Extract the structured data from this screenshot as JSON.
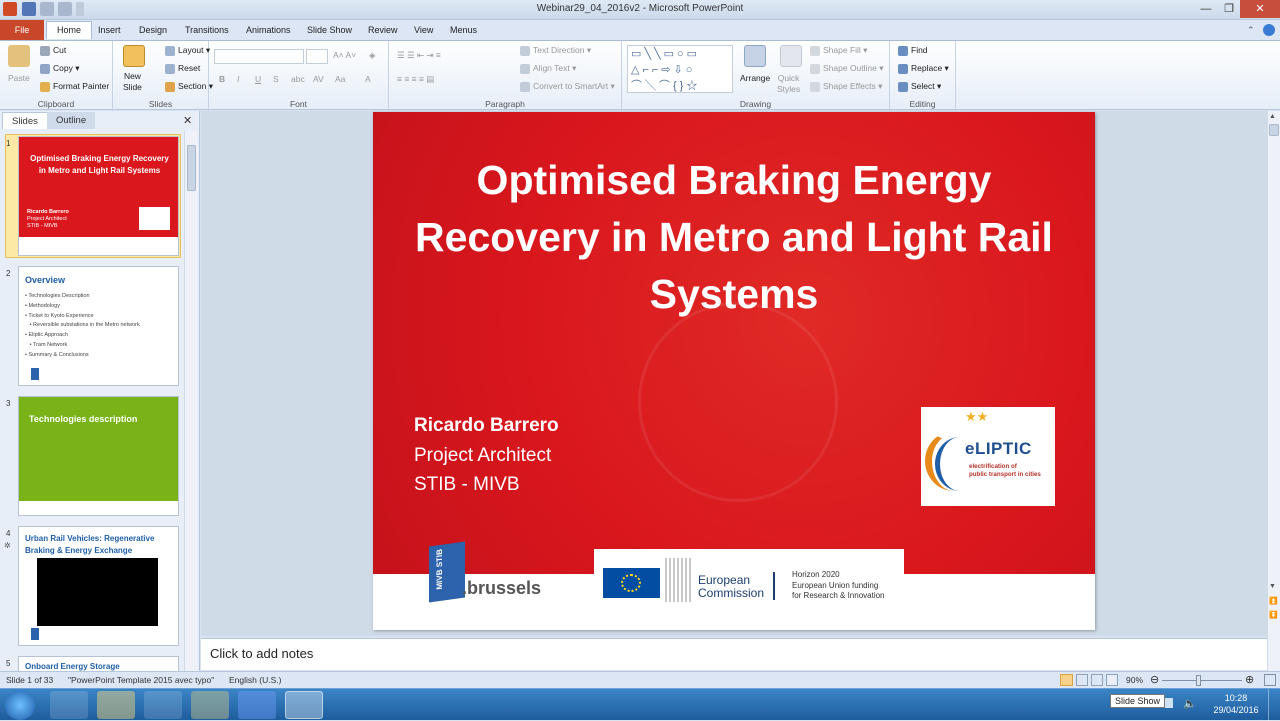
{
  "window": {
    "title": "Webinar29_04_2016v2 - Microsoft PowerPoint",
    "minimize": "—",
    "maximize": "❐",
    "close": "✕"
  },
  "tabs": [
    "Insert",
    "Design",
    "Transitions",
    "Animations",
    "Slide Show",
    "Review",
    "View",
    "Menus"
  ],
  "file_tab": "File",
  "home_tab": "Home",
  "ribbon": {
    "clipboard": {
      "paste": "Paste",
      "cut": "Cut",
      "copy": "Copy",
      "format_painter": "Format Painter",
      "label": "Clipboard"
    },
    "slides": {
      "new_slide": "New\nSlide",
      "layout": "Layout",
      "reset": "Reset",
      "section": "Section",
      "label": "Slides"
    },
    "font": {
      "label": "Font"
    },
    "paragraph": {
      "text_direction": "Text Direction",
      "align_text": "Align Text",
      "convert": "Convert to SmartArt",
      "label": "Paragraph"
    },
    "drawing": {
      "arrange": "Arrange",
      "quick_styles": "Quick\nStyles",
      "shape_fill": "Shape Fill",
      "shape_outline": "Shape Outline",
      "shape_effects": "Shape Effects",
      "label": "Drawing"
    },
    "editing": {
      "find": "Find",
      "replace": "Replace",
      "select": "Select",
      "label": "Editing"
    }
  },
  "panel": {
    "tab_slides": "Slides",
    "tab_outline": "Outline",
    "close": "✕"
  },
  "thumbs": [
    {
      "num": "1",
      "title": "Optimised Braking Energy Recovery  in Metro and Light Rail Systems",
      "l1": "Ricardo Barrero",
      "l2": "Project Architect",
      "l3": "STIB - MIVB"
    },
    {
      "num": "2",
      "title": "Overview",
      "bullets": [
        "• Technologies Description",
        "• Methodology",
        "• Ticket to Kyoto Experience",
        "   • Reversible substations in the Metro network",
        "• Eliptic Approach",
        "   • Tram Network",
        "• Summary & Conclusions"
      ]
    },
    {
      "num": "3",
      "title": "Technologies description"
    },
    {
      "num": "4",
      "title": "Urban Rail Vehicles: Regenerative Braking & Energy Exchange"
    },
    {
      "num": "5",
      "title": "Onboard Energy Storage"
    }
  ],
  "slide": {
    "title": "Optimised Braking Energy Recovery in Metro and Light Rail Systems",
    "name": "Ricardo Barrero",
    "role": "Project Architect",
    "org": "STIB - MIVB",
    "eliptic_logo": "eLIPTIC",
    "eliptic_sub1": "electrification of",
    "eliptic_sub2": "public transport in cities",
    "stib_mark": "MIVB STIB",
    "brussels": ".brussels",
    "ec": "European\nCommission",
    "horizon1": "Horizon 2020",
    "horizon2": "European Union funding",
    "horizon3": "for Research & Innovation"
  },
  "notes_placeholder": "Click to add notes",
  "status": {
    "slide": "Slide 1 of 33",
    "template": "\"PowerPoint Template 2015 avec typo\"",
    "lang": "English (U.S.)",
    "zoom": "90%",
    "tooltip": "Slide Show"
  },
  "tray": {
    "time": "10:28",
    "date": "29/04/2016"
  },
  "colors": {
    "slide_red": "#d9171d",
    "thumb_green": "#7ab317",
    "title_blue": "#1f5fa8"
  }
}
